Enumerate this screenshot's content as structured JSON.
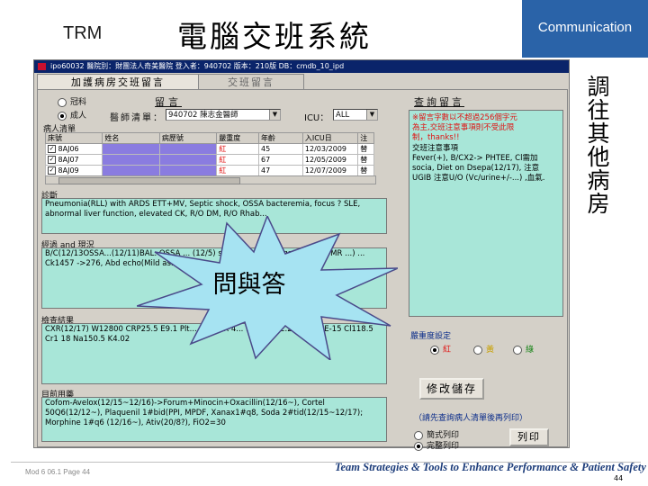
{
  "slide": {
    "trm": "TRM",
    "title_zh": "電腦交班系統",
    "comm_label": "Communication",
    "vertical_note": "調往其他病房",
    "burst_text": "問與答",
    "footer_left": "Mod 6 06.1  Page 44",
    "footer_tagline": "Team Strategies & Tools to Enhance Performance & Patient Safety",
    "page_number": "44"
  },
  "window": {
    "title": "ipo60032  醫院別：財團法人奇美醫院  登入者：940702  版本：210版  DB：cmdb_10_ipd",
    "tab_ward": "加護病房交班留言",
    "tab_handoff": "交班留言"
  },
  "filters": {
    "radio_a": "冠科",
    "radio_b": "成人",
    "doctor_label": "醫師清單：",
    "doctor_value": "940702 陳志金醫師",
    "icu_label": "ICU：",
    "icu_value": "ALL"
  },
  "messages": {
    "leave_msg_header": "留言",
    "query_msg_header": "查詢留言"
  },
  "patient_list": {
    "label": "病人清單",
    "columns": [
      "床號",
      "姓名",
      "病歷號",
      "嚴重度",
      "年齡",
      "入ICU日",
      "注"
    ],
    "rows": [
      {
        "bed": "8AJ06",
        "severity": "紅",
        "age": "45",
        "date": "12/03/2009",
        "note": "替"
      },
      {
        "bed": "8AJ07",
        "severity": "紅",
        "age": "67",
        "date": "12/05/2009",
        "note": "替"
      },
      {
        "bed": "8AJ09",
        "severity": "紅",
        "age": "47",
        "date": "12/07/2009",
        "note": "替"
      }
    ]
  },
  "diagnosis": {
    "label": "診斷",
    "text": "Pneumonia(RLL) with ARDS ETT+MV, Septic shock, OSSA bacteremia, focus ? SLE, abnormal liver function, elevated CK, R/O DM, R/O Rhab..."
  },
  "course": {
    "label": "經過 and 現況",
    "text": "B/C(12/13OSSA...(12/11)BAL: OSSA ... (12/5) sputum:... / vcltagat CV(mild MR ...) ... Ck1457 ->276, Abd echo(Mild as...)"
  },
  "lab": {
    "label": "檢查結果",
    "text": "CXR(12/17) W12800 CRP25.5 E9.1 Plt... 0.8 TnR 4... K276 Alb2.2 ... 1.8 BE-15 Cl118.5 Cr1 18 Na150.5 K4.02"
  },
  "meds": {
    "label": "目前用藥",
    "text": "Cofom-Avelox(12/15~12/16)->Forum+Minocin+Oxacillin(12/16~), Cortel 50Q6(12/12~), Plaquenil 1#bid(PPI, MPDF, Xanax1#q8, Soda 2#tid(12/15~12/17); Morphine 1#q6 (12/16~), Ativ(20/8?), FiO2=30"
  },
  "notice": {
    "red_text": "※留言字數以不超過256個字元\n為主,交班注意事項則不受此限\n制，thanks!!",
    "label": "交班注意事項",
    "text": "Fever(+), B/CX2-> PHTEE, Cl需加 socia, Diet on Dsepa(12/17), 注意 UGIB 注意U/O (Vc/urine+/-...) ,血氣."
  },
  "severity": {
    "label": "嚴重度設定",
    "options": [
      "紅",
      "黃",
      "綠"
    ]
  },
  "buttons": {
    "save": "修改儲存",
    "print": "列印"
  },
  "print_section": {
    "hint": "（請先查詢病人清單後再列印）",
    "option_simple": "簡式列印",
    "option_full": "完整列印"
  },
  "colors": {
    "comm_bar": "#2a63a8",
    "teal_box": "#a8e6d8",
    "title_bar": "#0a246a",
    "name_highlight": "#8a7ce0",
    "severity_red": "#e01010"
  }
}
